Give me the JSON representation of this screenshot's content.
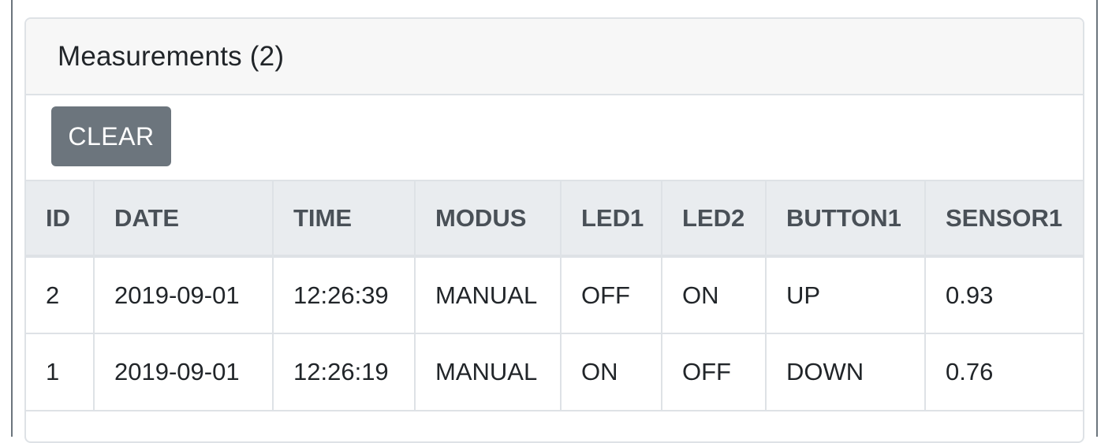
{
  "panel": {
    "title": "Measurements (2)",
    "clear_label": "CLEAR"
  },
  "table": {
    "headers": [
      "ID",
      "DATE",
      "TIME",
      "MODUS",
      "LED1",
      "LED2",
      "BUTTON1",
      "SENSOR1"
    ],
    "rows": [
      [
        "2",
        "2019-09-01",
        "12:26:39",
        "MANUAL",
        "OFF",
        "ON",
        "UP",
        "0.93"
      ],
      [
        "1",
        "2019-09-01",
        "12:26:19",
        "MANUAL",
        "ON",
        "OFF",
        "DOWN",
        "0.76"
      ]
    ]
  },
  "colors": {
    "button_bg": "#6c757d",
    "header_bg": "#f7f7f7",
    "table_head_bg": "#e9ecef",
    "border": "#dee2e6"
  }
}
